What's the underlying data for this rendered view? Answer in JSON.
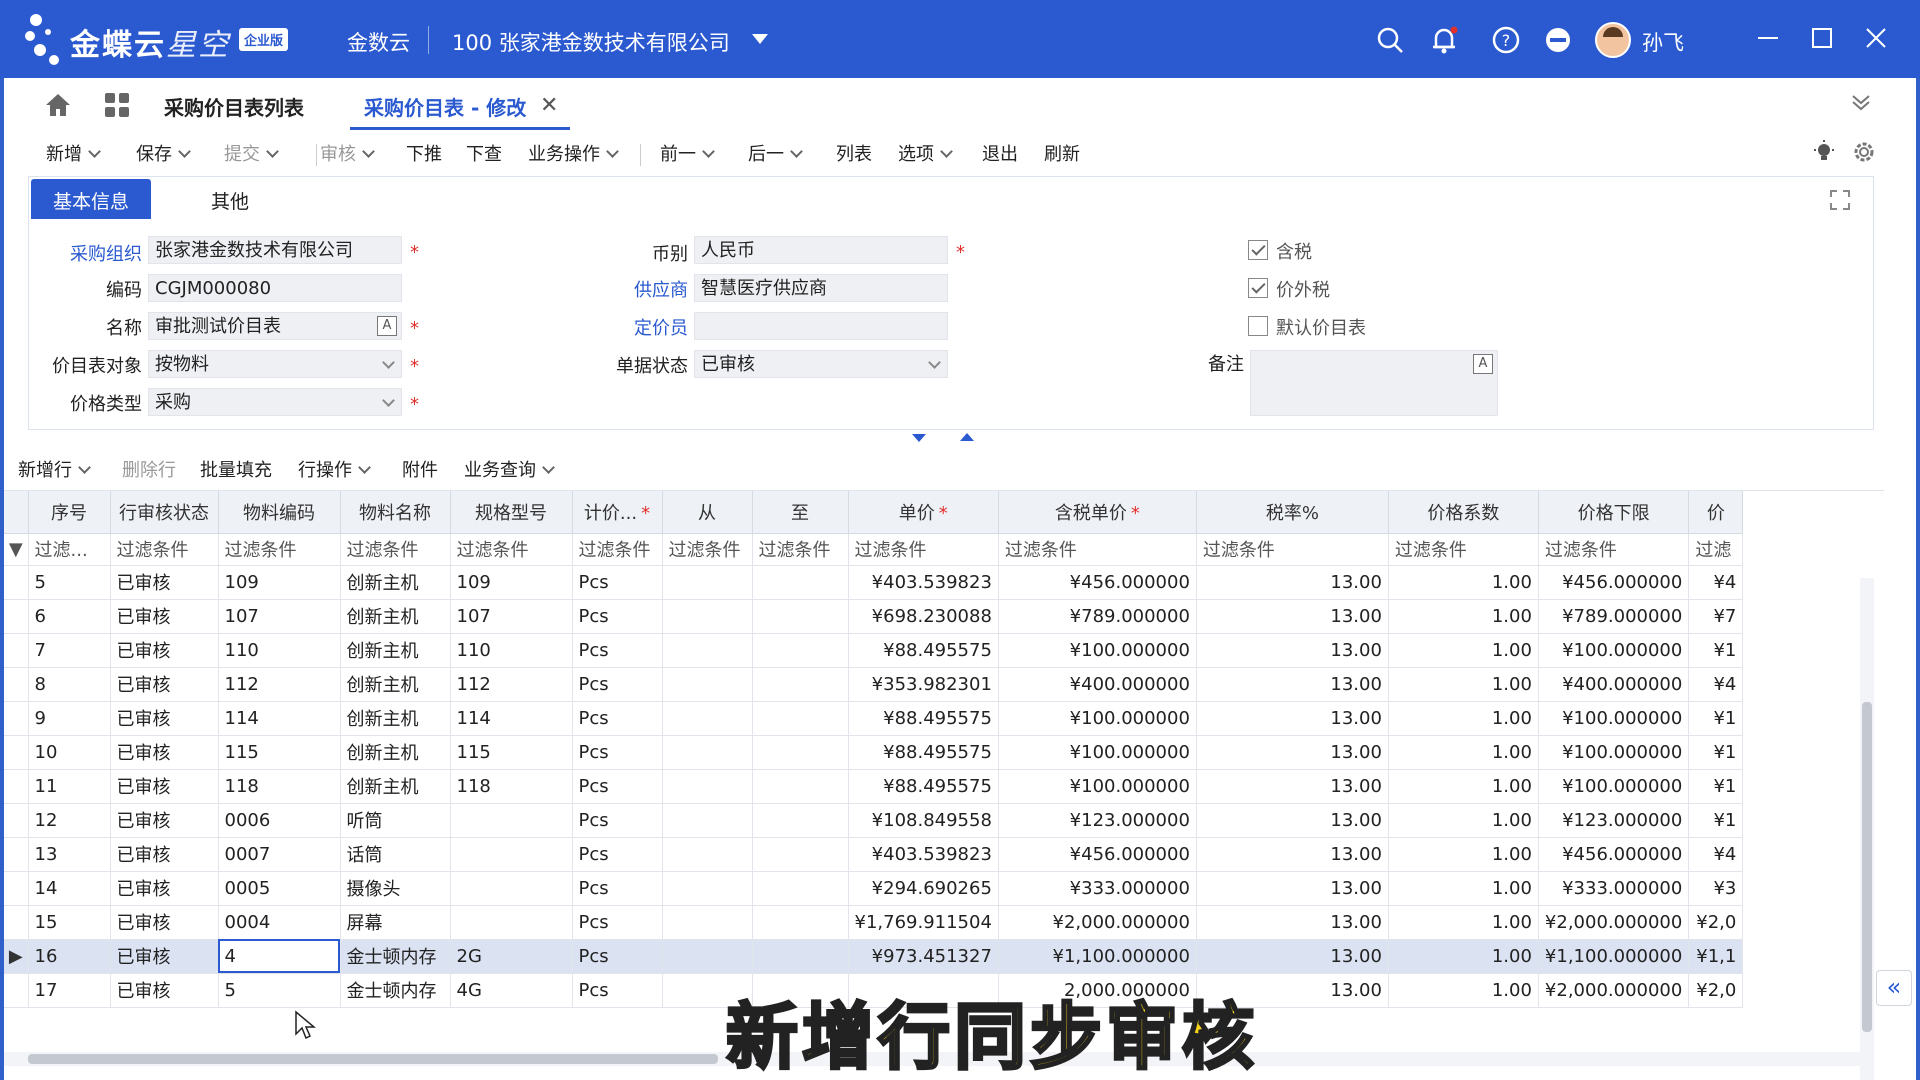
{
  "app": {
    "brand_main": "金蝶云",
    "brand_sub": "星空",
    "edition": "企业版",
    "cloud_name": "金数云",
    "company": "100  张家港金数技术有限公司",
    "username": "孙飞"
  },
  "tabs": {
    "list_label": "采购价目表列表",
    "active_label": "采购价目表 - 修改"
  },
  "toolbar": [
    {
      "label": "新增",
      "caret": true,
      "disabled": false
    },
    {
      "label": "保存",
      "caret": true,
      "disabled": false
    },
    {
      "label": "提交",
      "caret": true,
      "disabled": true
    },
    {
      "label": "审核",
      "caret": true,
      "disabled": true
    },
    {
      "label": "下推",
      "caret": false,
      "disabled": false
    },
    {
      "label": "下查",
      "caret": false,
      "disabled": false
    },
    {
      "label": "业务操作",
      "caret": true,
      "disabled": false
    },
    {
      "label": "前一",
      "caret": true,
      "disabled": false
    },
    {
      "label": "后一",
      "caret": true,
      "disabled": false
    },
    {
      "label": "列表",
      "caret": false,
      "disabled": false
    },
    {
      "label": "选项",
      "caret": true,
      "disabled": false
    },
    {
      "label": "退出",
      "caret": false,
      "disabled": false
    },
    {
      "label": "刷新",
      "caret": false,
      "disabled": false
    }
  ],
  "form_tabs": {
    "basic": "基本信息",
    "other": "其他"
  },
  "form": {
    "purchase_org_label": "采购组织",
    "purchase_org_value": "张家港金数技术有限公司",
    "code_label": "编码",
    "code_value": "CGJM000080",
    "name_label": "名称",
    "name_value": "审批测试价目表",
    "target_label": "价目表对象",
    "target_value": "按物料",
    "price_type_label": "价格类型",
    "price_type_value": "采购",
    "currency_label": "币别",
    "currency_value": "人民币",
    "supplier_label": "供应商",
    "supplier_value": "智慧医疗供应商",
    "pricer_label": "定价员",
    "pricer_value": "",
    "status_label": "单据状态",
    "status_value": "已审核",
    "tax_included_label": "含税",
    "tax_included": true,
    "tax_excluded_label": "价外税",
    "tax_excluded": true,
    "default_list_label": "默认价目表",
    "default_list": false,
    "remark_label": "备注",
    "required_mark": "*",
    "a_glyph": "A"
  },
  "grid_toolbar": [
    {
      "label": "新增行",
      "caret": true,
      "disabled": false
    },
    {
      "label": "删除行",
      "caret": false,
      "disabled": true
    },
    {
      "label": "批量填充",
      "caret": false,
      "disabled": false
    },
    {
      "label": "行操作",
      "caret": true,
      "disabled": false
    },
    {
      "label": "附件",
      "caret": false,
      "disabled": false
    },
    {
      "label": "业务查询",
      "caret": true,
      "disabled": false
    }
  ],
  "grid": {
    "columns": [
      {
        "label": "序号",
        "required": false
      },
      {
        "label": "行审核状态",
        "required": false
      },
      {
        "label": "物料编码",
        "required": false
      },
      {
        "label": "物料名称",
        "required": false
      },
      {
        "label": "规格型号",
        "required": false
      },
      {
        "label": "计价...",
        "required": true
      },
      {
        "label": "从",
        "required": false
      },
      {
        "label": "至",
        "required": false
      },
      {
        "label": "单价",
        "required": true
      },
      {
        "label": "含税单价",
        "required": true
      },
      {
        "label": "税率%",
        "required": false
      },
      {
        "label": "价格系数",
        "required": false
      },
      {
        "label": "价格下限",
        "required": false
      },
      {
        "label": "价",
        "required": false
      }
    ],
    "filters": [
      "过滤...",
      "过滤条件",
      "过滤条件",
      "过滤条件",
      "过滤条件",
      "过滤条件",
      "过滤条件",
      "过滤条件",
      "过滤条件",
      "过滤条件",
      "过滤条件",
      "过滤条件",
      "过滤条件",
      "过滤"
    ],
    "rows": [
      [
        "5",
        "已审核",
        "109",
        "创新主机",
        "109",
        "Pcs",
        "",
        "",
        "¥403.539823",
        "¥456.000000",
        "13.00",
        "1.00",
        "¥456.000000",
        "¥4"
      ],
      [
        "6",
        "已审核",
        "107",
        "创新主机",
        "107",
        "Pcs",
        "",
        "",
        "¥698.230088",
        "¥789.000000",
        "13.00",
        "1.00",
        "¥789.000000",
        "¥7"
      ],
      [
        "7",
        "已审核",
        "110",
        "创新主机",
        "110",
        "Pcs",
        "",
        "",
        "¥88.495575",
        "¥100.000000",
        "13.00",
        "1.00",
        "¥100.000000",
        "¥1"
      ],
      [
        "8",
        "已审核",
        "112",
        "创新主机",
        "112",
        "Pcs",
        "",
        "",
        "¥353.982301",
        "¥400.000000",
        "13.00",
        "1.00",
        "¥400.000000",
        "¥4"
      ],
      [
        "9",
        "已审核",
        "114",
        "创新主机",
        "114",
        "Pcs",
        "",
        "",
        "¥88.495575",
        "¥100.000000",
        "13.00",
        "1.00",
        "¥100.000000",
        "¥1"
      ],
      [
        "10",
        "已审核",
        "115",
        "创新主机",
        "115",
        "Pcs",
        "",
        "",
        "¥88.495575",
        "¥100.000000",
        "13.00",
        "1.00",
        "¥100.000000",
        "¥1"
      ],
      [
        "11",
        "已审核",
        "118",
        "创新主机",
        "118",
        "Pcs",
        "",
        "",
        "¥88.495575",
        "¥100.000000",
        "13.00",
        "1.00",
        "¥100.000000",
        "¥1"
      ],
      [
        "12",
        "已审核",
        "0006",
        "听筒",
        "",
        "Pcs",
        "",
        "",
        "¥108.849558",
        "¥123.000000",
        "13.00",
        "1.00",
        "¥123.000000",
        "¥1"
      ],
      [
        "13",
        "已审核",
        "0007",
        "话筒",
        "",
        "Pcs",
        "",
        "",
        "¥403.539823",
        "¥456.000000",
        "13.00",
        "1.00",
        "¥456.000000",
        "¥4"
      ],
      [
        "14",
        "已审核",
        "0005",
        "摄像头",
        "",
        "Pcs",
        "",
        "",
        "¥294.690265",
        "¥333.000000",
        "13.00",
        "1.00",
        "¥333.000000",
        "¥3"
      ],
      [
        "15",
        "已审核",
        "0004",
        "屏幕",
        "",
        "Pcs",
        "",
        "",
        "¥1,769.911504",
        "¥2,000.000000",
        "13.00",
        "1.00",
        "¥2,000.000000",
        "¥2,0"
      ],
      [
        "16",
        "已审核",
        "4",
        "金士顿内存",
        "2G",
        "Pcs",
        "",
        "",
        "¥973.451327",
        "¥1,100.000000",
        "13.00",
        "1.00",
        "¥1,100.000000",
        "¥1,1"
      ],
      [
        "17",
        "已审核",
        "5",
        "金士顿内存",
        "4G",
        "Pcs",
        "",
        "",
        "",
        "2,000.000000",
        "13.00",
        "1.00",
        "¥2,000.000000",
        "¥2,0"
      ]
    ],
    "selected_row": 11
  },
  "caption": "新增行同步审核",
  "colors": {
    "brand": "#2b5ad0",
    "required": "#e0302b",
    "caption": "#f7d21b"
  }
}
